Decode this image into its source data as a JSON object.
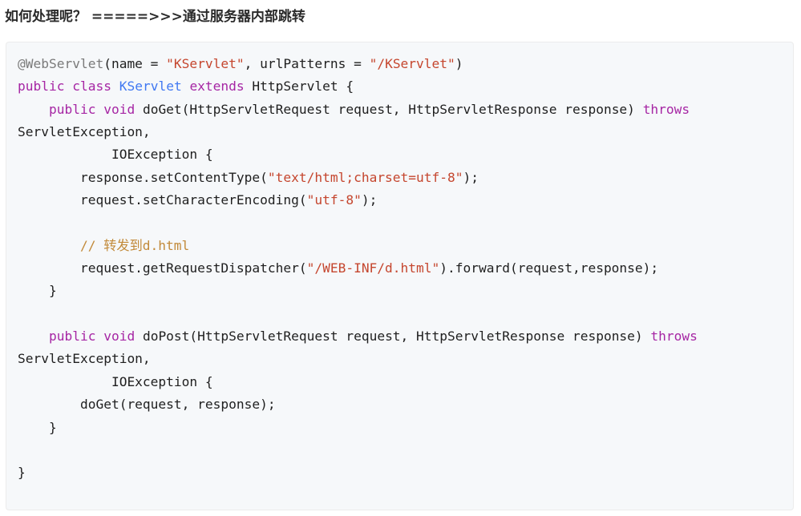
{
  "heading": "如何处理呢？ =====>>>通过服务器内部跳转",
  "code_block": {
    "language": "java",
    "lines": [
      [
        {
          "t": "annotation",
          "v": "@WebServlet"
        },
        {
          "t": "plain",
          "v": "(name = "
        },
        {
          "t": "string",
          "v": "\"KServlet\""
        },
        {
          "t": "plain",
          "v": ", urlPatterns = "
        },
        {
          "t": "string",
          "v": "\"/KServlet\""
        },
        {
          "t": "plain",
          "v": ")"
        }
      ],
      [
        {
          "t": "keyword",
          "v": "public"
        },
        {
          "t": "plain",
          "v": " "
        },
        {
          "t": "keyword",
          "v": "class"
        },
        {
          "t": "plain",
          "v": " "
        },
        {
          "t": "class-name",
          "v": "KServlet"
        },
        {
          "t": "plain",
          "v": " "
        },
        {
          "t": "keyword",
          "v": "extends"
        },
        {
          "t": "plain",
          "v": " HttpServlet {"
        }
      ],
      [
        {
          "t": "plain",
          "v": "    "
        },
        {
          "t": "keyword",
          "v": "public"
        },
        {
          "t": "plain",
          "v": " "
        },
        {
          "t": "keyword",
          "v": "void"
        },
        {
          "t": "plain",
          "v": " doGet(HttpServletRequest request, HttpServletResponse response) "
        },
        {
          "t": "keyword",
          "v": "throws"
        }
      ],
      [
        {
          "t": "plain",
          "v": "ServletException,"
        }
      ],
      [
        {
          "t": "plain",
          "v": "            IOException {"
        }
      ],
      [
        {
          "t": "plain",
          "v": "        response.setContentType("
        },
        {
          "t": "string",
          "v": "\"text/html;charset=utf-8\""
        },
        {
          "t": "plain",
          "v": ");"
        }
      ],
      [
        {
          "t": "plain",
          "v": "        request.setCharacterEncoding("
        },
        {
          "t": "string",
          "v": "\"utf-8\""
        },
        {
          "t": "plain",
          "v": ");"
        }
      ],
      [],
      [
        {
          "t": "plain",
          "v": "        "
        },
        {
          "t": "comment",
          "v": "// 转发到d.html"
        }
      ],
      [
        {
          "t": "plain",
          "v": "        request.getRequestDispatcher("
        },
        {
          "t": "string",
          "v": "\"/WEB-INF/d.html\""
        },
        {
          "t": "plain",
          "v": ").forward(request,response);"
        }
      ],
      [
        {
          "t": "plain",
          "v": "    }"
        }
      ],
      [],
      [
        {
          "t": "plain",
          "v": "    "
        },
        {
          "t": "keyword",
          "v": "public"
        },
        {
          "t": "plain",
          "v": " "
        },
        {
          "t": "keyword",
          "v": "void"
        },
        {
          "t": "plain",
          "v": " doPost(HttpServletRequest request, HttpServletResponse response) "
        },
        {
          "t": "keyword",
          "v": "throws"
        }
      ],
      [
        {
          "t": "plain",
          "v": "ServletException,"
        }
      ],
      [
        {
          "t": "plain",
          "v": "            IOException {"
        }
      ],
      [
        {
          "t": "plain",
          "v": "        doGet(request, response);"
        }
      ],
      [
        {
          "t": "plain",
          "v": "    }"
        }
      ],
      [],
      [
        {
          "t": "plain",
          "v": "}"
        }
      ]
    ]
  },
  "colors": {
    "keyword": "#a626a4",
    "class_name": "#4078f2",
    "string": "#c5462e",
    "comment": "#c28a3a",
    "annotation": "#7a7a7a",
    "code_background": "#f6f8fa"
  }
}
